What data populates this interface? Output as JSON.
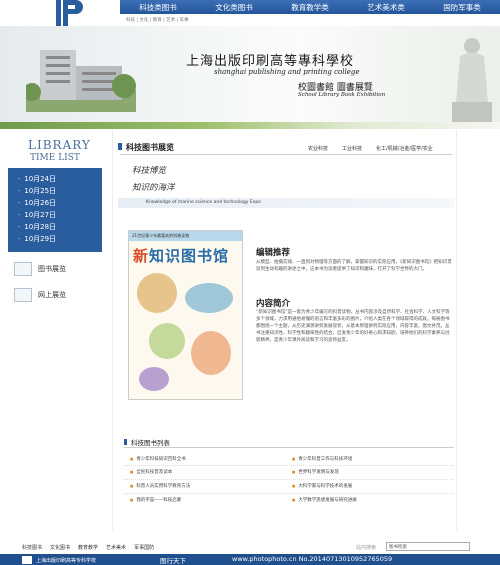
{
  "header": {
    "nav": [
      "科技类图书",
      "文化类图书",
      "教育教学类",
      "艺术美术类",
      "国防军事类"
    ],
    "breadcrumb": "科技 | 文化 | 教育 | 艺术 | 军事"
  },
  "banner": {
    "title_cn": "上海出版印刷高等專科學校",
    "title_en": "shanghai publishing and printing college",
    "subtitle_cn": "校圖書館 圖書展覽",
    "subtitle_en": "School Library Book Exhibition"
  },
  "sidebar": {
    "library": "LIBRARY",
    "time_list": "TIME LIST",
    "dates": [
      "10月24日",
      "10月25日",
      "10月26日",
      "10月27日",
      "10月28日",
      "10月29日"
    ],
    "links": [
      "图书展览",
      "网上展览"
    ]
  },
  "section": {
    "title": "科技图书展览",
    "tabs": [
      "农业科技",
      "工业科技",
      "化工/机械/冶金/医学/农业"
    ],
    "handwriting1": "科技博览",
    "handwriting2": "知识的海洋",
    "expo": "Knowledge of marine science and technology Expo"
  },
  "book": {
    "header": "21世纪青少年最喜欢的科普读物",
    "title": "新知识图书馆"
  },
  "content": {
    "recommend_title": "编辑推荐",
    "recommend_text": "从模型、拍摄实践、一直到对物理等方面的了解，掌握知识的实际应用。《新知识图书馆》把知识贯穿到生动有趣的讲述之中，这本书为读者提供了知识和趣味，打开了科学世界的大门。",
    "summary_title": "内容简介",
    "summary_text": "“新知识图书馆”是一套为青少年编写的科普读物，丛书内容涉及自然科学、社会科学、人文科学等多个领域，力求用通俗易懂的语言和丰富多彩的图片，介绍人类在各个领域取得的成就。每册图书都围绕一个主题，从历史渊源讲到发展现状，从基本原理讲到实际应用，内容丰富，图文并茂。丛书注重知识性、科学性和趣味性的结合，启发青少年的好奇心和求知欲，培养他们的科学素养与创新精神，是青少年课外阅读和学习的良师益友。"
  },
  "list": {
    "title": "科技图书列表",
    "items": [
      "青少年科技知识百科全书",
      "全民科技普及读本",
      "科普人员实用科学教育方法",
      "我的宇宙——科技启蒙",
      "青少年科普工作与科技环境",
      "世界科学发明与发现",
      "大科学家与科学技术的发展",
      "大学数学思想发展与研究进展"
    ]
  },
  "footer": {
    "nav": [
      "科技图书",
      "文化图书",
      "教育教学",
      "艺术美术",
      "军事国防"
    ],
    "search_label": "站内搜索",
    "search_value": "图书检索",
    "school": "上海出版印刷高等专科学校",
    "watermark1": "图行天下",
    "watermark2": "www.photophoto.cn  No.20140713010952765059"
  }
}
